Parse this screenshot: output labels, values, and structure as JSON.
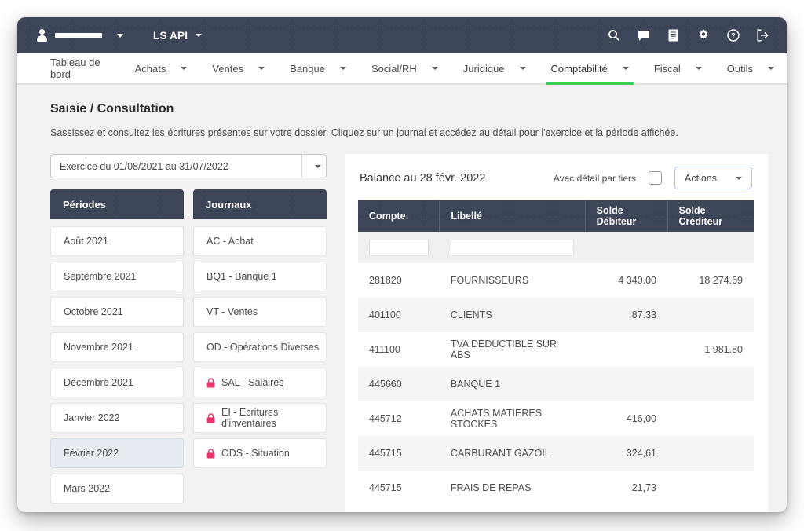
{
  "topbar": {
    "user_icon": "user-icon",
    "user_name_redacted": true,
    "app_name": "LS API",
    "icons": [
      {
        "name": "search-icon",
        "label": "Rechercher"
      },
      {
        "name": "chat-icon",
        "label": "Messages"
      },
      {
        "name": "document-icon",
        "label": "Documents"
      },
      {
        "name": "gear-icon",
        "label": "Paramètres"
      },
      {
        "name": "help-icon",
        "label": "Aide"
      },
      {
        "name": "logout-icon",
        "label": "Déconnexion"
      }
    ]
  },
  "nav": {
    "active": "Comptabilité",
    "accent_color": "#3fcb5b",
    "items": [
      {
        "label": "Tableau de bord",
        "caret": false
      },
      {
        "label": "Achats",
        "caret": true
      },
      {
        "label": "Ventes",
        "caret": true
      },
      {
        "label": "Banque",
        "caret": true
      },
      {
        "label": "Social/RH",
        "caret": true
      },
      {
        "label": "Juridique",
        "caret": true
      },
      {
        "label": "Comptabilité",
        "caret": true
      },
      {
        "label": "Fiscal",
        "caret": true
      },
      {
        "label": "Outils",
        "caret": true
      }
    ]
  },
  "page": {
    "title": "Saisie / Consultation",
    "description": "Sassissez et consultez les écritures présentes sur votre dossier. Cliquez sur un journal et accédez au détail pour l'exercice et la période affichée."
  },
  "exercise_select": {
    "value": "Exercice du 01/08/2021 au 31/07/2022",
    "caret_icon": "chevron-down-icon"
  },
  "periodes": {
    "header": "Périodes",
    "selected": "Février 2022",
    "items": [
      {
        "label": "Août 2021",
        "locked": false
      },
      {
        "label": "Septembre 2021",
        "locked": false
      },
      {
        "label": "Octobre 2021",
        "locked": false
      },
      {
        "label": "Novembre 2021",
        "locked": false
      },
      {
        "label": "Décembre 2021",
        "locked": false
      },
      {
        "label": "Janvier 2022",
        "locked": false
      },
      {
        "label": "Février 2022",
        "locked": false
      },
      {
        "label": "Mars 2022",
        "locked": false
      }
    ]
  },
  "journaux": {
    "header": "Journaux",
    "lock_color": "#e8366e",
    "items": [
      {
        "label": "AC - Achat",
        "locked": false
      },
      {
        "label": "BQ1 - Banque 1",
        "locked": false
      },
      {
        "label": "VT - Ventes",
        "locked": false
      },
      {
        "label": "OD - Opérations Diverses",
        "locked": false
      },
      {
        "label": "SAL - Salaires",
        "locked": true
      },
      {
        "label": "EI - Ecritures d'inventaires",
        "locked": true
      },
      {
        "label": "ODS - Situation",
        "locked": true
      }
    ]
  },
  "balance_panel": {
    "title": "Balance au 28 févr. 2022",
    "checkbox_label": "Avec détail par tiers",
    "checkbox_checked": false,
    "actions_label": "Actions",
    "actions_caret_icon": "chevron-down-icon",
    "columns": [
      "Compte",
      "Libellé",
      "Solde Débiteur",
      "Solde Créditeur"
    ],
    "filter_row": {
      "compte_value": "",
      "libelle_value": ""
    },
    "rows": [
      {
        "compte": "281820",
        "libelle": "FOURNISSEURS",
        "debiteur": "4 340.00",
        "crediteur": "18 274.69"
      },
      {
        "compte": "401100",
        "libelle": "CLIENTS",
        "debiteur": "87.33",
        "crediteur": ""
      },
      {
        "compte": "411100",
        "libelle": "TVA DEDUCTIBLE SUR ABS",
        "debiteur": "",
        "crediteur": "1 981.80"
      },
      {
        "compte": "445660",
        "libelle": "BANQUE 1",
        "debiteur": "",
        "crediteur": ""
      },
      {
        "compte": "445712",
        "libelle": "ACHATS MATIERES STOCKES",
        "debiteur": "416,00",
        "crediteur": ""
      },
      {
        "compte": "445715",
        "libelle": "CARBURANT GAZOIL",
        "debiteur": "324,61",
        "crediteur": ""
      },
      {
        "compte": "445715",
        "libelle": "FRAIS DE REPAS",
        "debiteur": "21,73",
        "crediteur": ""
      }
    ]
  }
}
